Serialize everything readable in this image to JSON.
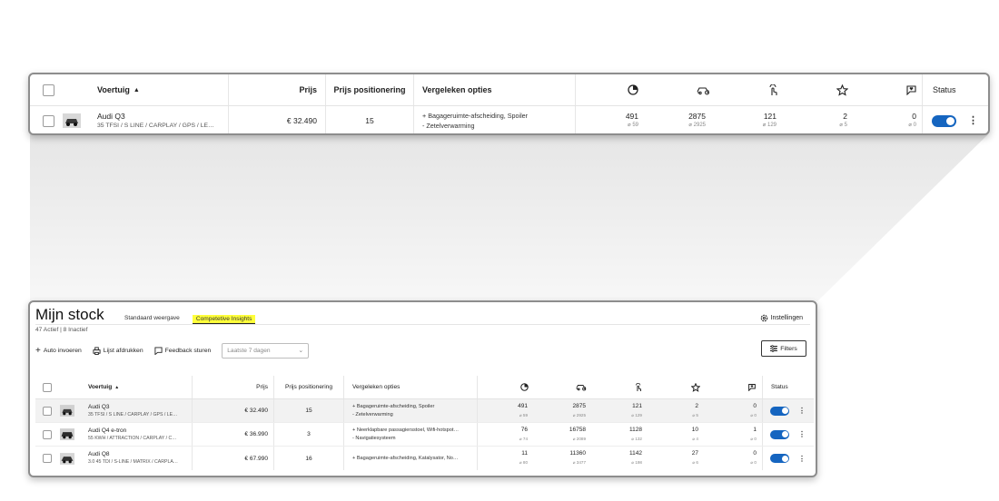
{
  "colors": {
    "toggle_on": "#1565c0",
    "tab_highlight": "#ffff3a",
    "frame_border": "#8d8d8d"
  },
  "columns": {
    "vehicle": "Voertuig",
    "price": "Prijs",
    "positioning": "Prijs positionering",
    "options": "Vergeleken opties",
    "status": "Status",
    "stat_icons": [
      "pie-chart-icon",
      "car-search-icon",
      "tap-icon",
      "star-icon",
      "heart-chat-icon"
    ]
  },
  "zoom_row": {
    "name": "Audi Q3",
    "subtitle": "35 TFSI / S LINE / CARPLAY / GPS / LE…",
    "price": "€ 32.490",
    "positioning": "15",
    "options": [
      "+ Bagageruimte-afscheiding, Spoiler",
      "- Zetelverwarming"
    ],
    "stats": [
      {
        "value": "491",
        "avg": "⌀ 59"
      },
      {
        "value": "2875",
        "avg": "⌀ 2925"
      },
      {
        "value": "121",
        "avg": "⌀ 129"
      },
      {
        "value": "2",
        "avg": "⌀ 5"
      },
      {
        "value": "0",
        "avg": "⌀ 0"
      }
    ]
  },
  "page": {
    "title": "Mijn stock",
    "tabs": [
      "Standaard weergave",
      "Competetive Insights"
    ],
    "active_tab": "Competetive Insights",
    "counts": "47 Actief  |  8 Inactief",
    "settings": "Instellingen",
    "actions": {
      "add": "Auto invoeren",
      "print": "Lijst afdrukken",
      "feedback": "Feedback sturen"
    },
    "date_filter": "Laatste 7 dagen",
    "filters": "Filters"
  },
  "rows": [
    {
      "name": "Audi Q3",
      "subtitle": "35 TFSI / S LINE / CARPLAY / GPS / LE…",
      "price": "€ 32.490",
      "positioning": "15",
      "options": [
        "+ Bagageruimte-afscheiding, Spoiler",
        "- Zetelverwarming"
      ],
      "stats": [
        {
          "value": "491",
          "avg": "⌀ 59"
        },
        {
          "value": "2875",
          "avg": "⌀ 2925"
        },
        {
          "value": "121",
          "avg": "⌀ 129"
        },
        {
          "value": "2",
          "avg": "⌀ 5"
        },
        {
          "value": "0",
          "avg": "⌀ 0"
        }
      ]
    },
    {
      "name": "Audi Q4 e-tron",
      "subtitle": "55 KWH / ATTRACTION / CARPLAY / C…",
      "price": "€ 36.990",
      "positioning": "3",
      "options": [
        "+ Neerklapbare passagiersstoel, Wifi-hotspot…",
        "- Navigatiesysteem"
      ],
      "stats": [
        {
          "value": "76",
          "avg": "⌀ 74"
        },
        {
          "value": "16758",
          "avg": "⌀ 2089"
        },
        {
          "value": "1128",
          "avg": "⌀ 132"
        },
        {
          "value": "10",
          "avg": "⌀ 4"
        },
        {
          "value": "1",
          "avg": "⌀ 0"
        }
      ]
    },
    {
      "name": "Audi Q8",
      "subtitle": "3.0 45 TDI / S-LINE / MATRIX / CARPLA…",
      "price": "€ 67.990",
      "positioning": "16",
      "options": [
        "+ Bagageruimte-afscheiding, Katalysator, No…"
      ],
      "stats": [
        {
          "value": "11",
          "avg": "⌀ 80"
        },
        {
          "value": "11360",
          "avg": "⌀ 3477"
        },
        {
          "value": "1142",
          "avg": "⌀ 198"
        },
        {
          "value": "27",
          "avg": "⌀ 6"
        },
        {
          "value": "0",
          "avg": "⌀ 0"
        }
      ]
    }
  ]
}
